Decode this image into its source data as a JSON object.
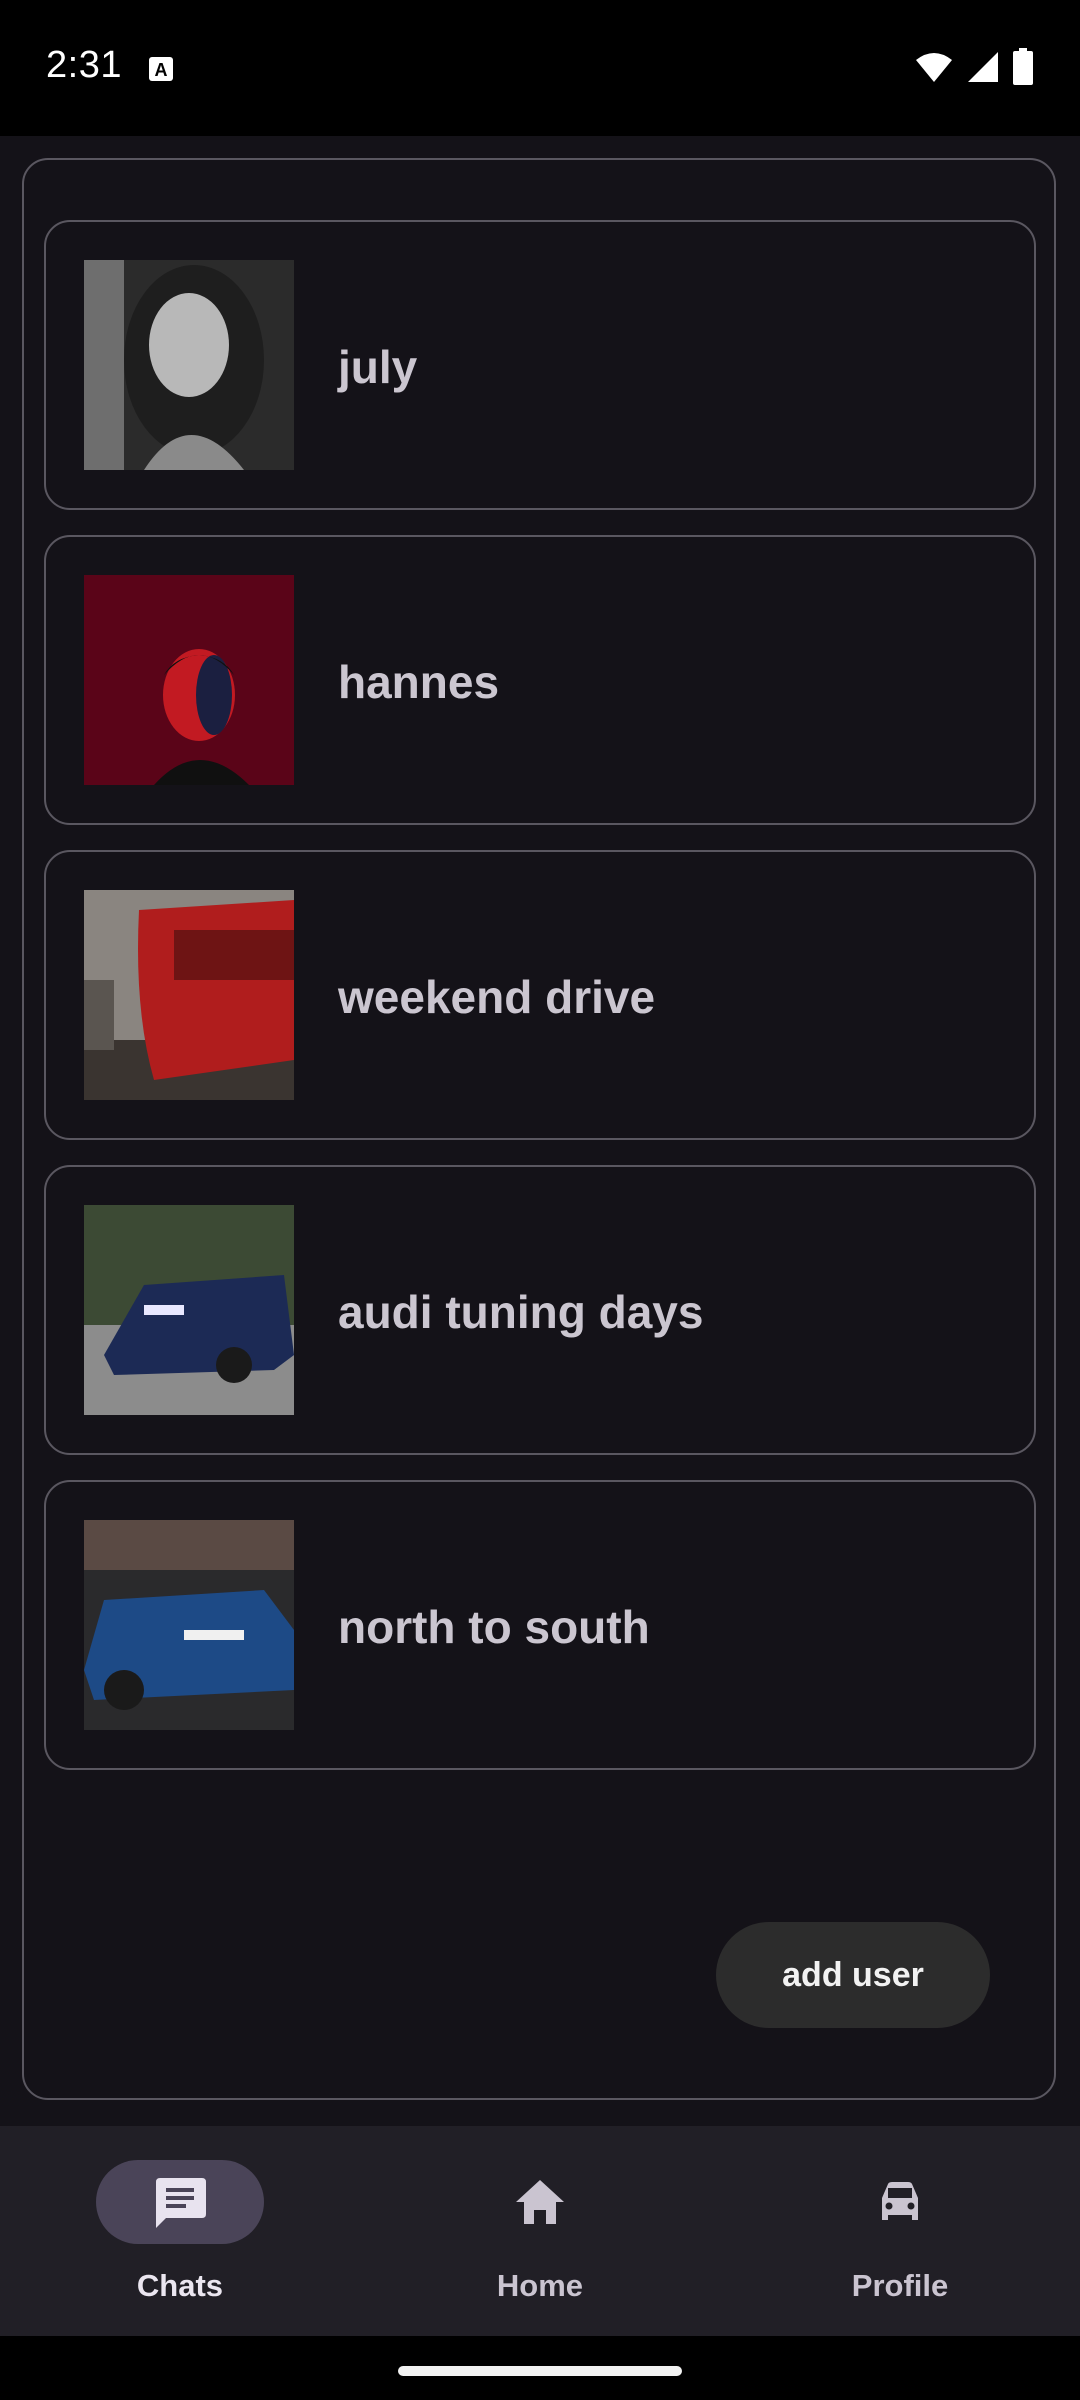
{
  "status_bar": {
    "time": "2:31",
    "icons": [
      "text-a-icon",
      "wifi-icon",
      "signal-icon",
      "battery-icon"
    ]
  },
  "chats": [
    {
      "label": "july",
      "thumbnail": "portrait-woman-bw"
    },
    {
      "label": "hannes",
      "thumbnail": "portrait-man-red-light"
    },
    {
      "label": "weekend drive",
      "thumbnail": "red-car-rear"
    },
    {
      "label": "audi tuning days",
      "thumbnail": "blue-audi-road"
    },
    {
      "label": "north to south",
      "thumbnail": "blue-audi-garage"
    }
  ],
  "add_user_label": "add user",
  "bottom_nav": {
    "items": [
      {
        "label": "Chats",
        "icon": "chat-icon",
        "active": true
      },
      {
        "label": "Home",
        "icon": "home-icon",
        "active": false
      },
      {
        "label": "Profile",
        "icon": "car-icon",
        "active": false
      }
    ]
  },
  "colors": {
    "background": "#141218",
    "card_border": "#5a5760",
    "text": "#cbc6d0",
    "nav_bar": "#211f26",
    "nav_active_pill": "#4a4458",
    "add_user_bg": "#2c2c2c"
  }
}
